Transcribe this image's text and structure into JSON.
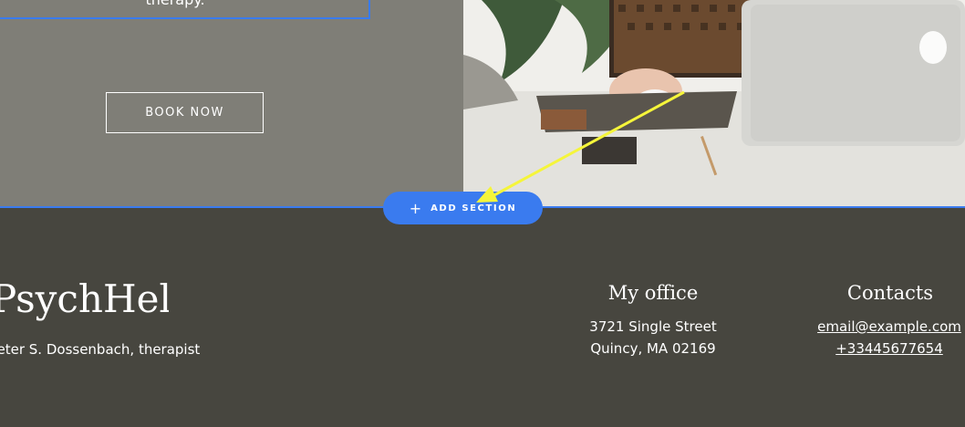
{
  "hero": {
    "text_fragment": "therapy.",
    "book_button_label": "BOOK NOW"
  },
  "editor": {
    "add_section_icon": "plus-icon",
    "add_section_label": "ADD SECTION",
    "accent_color": "#3a7bef"
  },
  "footer": {
    "logo_text": "PsychHelp",
    "therapist_line": "Peter S. Dossenbach, therapist",
    "office": {
      "title": "My office",
      "line1": "3721 Single Street",
      "line2": "Quincy, MA 02169"
    },
    "contacts": {
      "title": "Contacts",
      "email": "email@example.com",
      "phone": "+33445677654"
    }
  }
}
